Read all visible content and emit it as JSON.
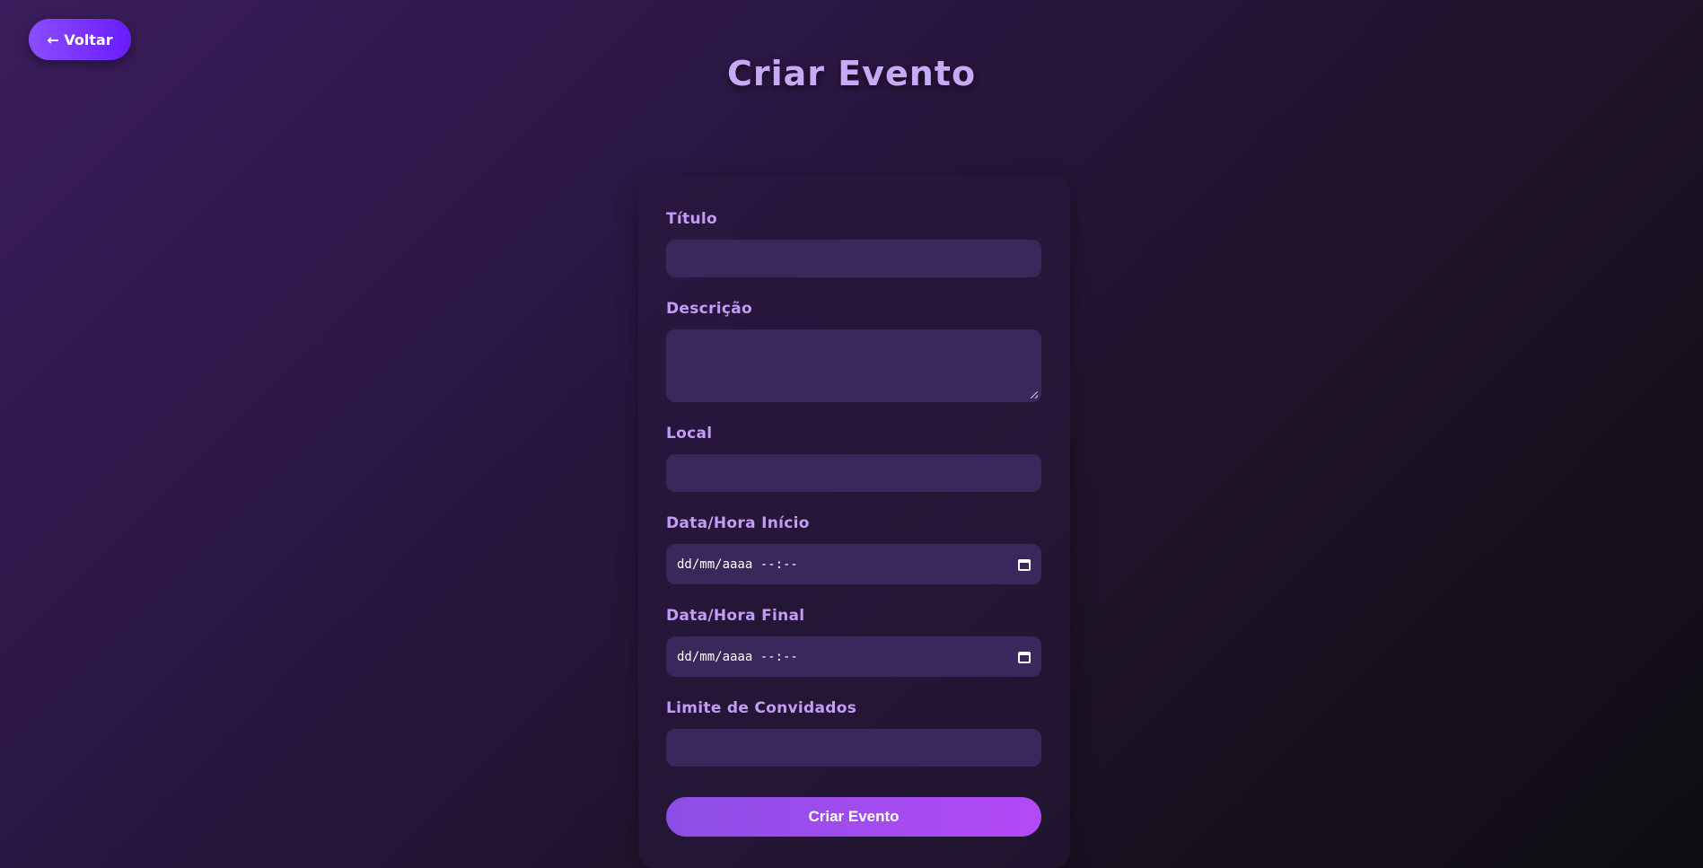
{
  "header": {
    "back_label": "← Voltar",
    "title": "Criar Evento"
  },
  "form": {
    "titulo_label": "Título",
    "descricao_label": "Descrição",
    "local_label": "Local",
    "inicio_label": "Data/Hora Início",
    "inicio_placeholder": "dd/mm/aaaa --:--",
    "final_label": "Data/Hora Final",
    "final_placeholder": "dd/mm/aaaa --:--",
    "limite_label": "Limite de Convidados",
    "submit_label": "Criar Evento"
  },
  "colors": {
    "accent": "#8b4dff",
    "label": "#c39cf6",
    "input_bg": "#38285c"
  }
}
